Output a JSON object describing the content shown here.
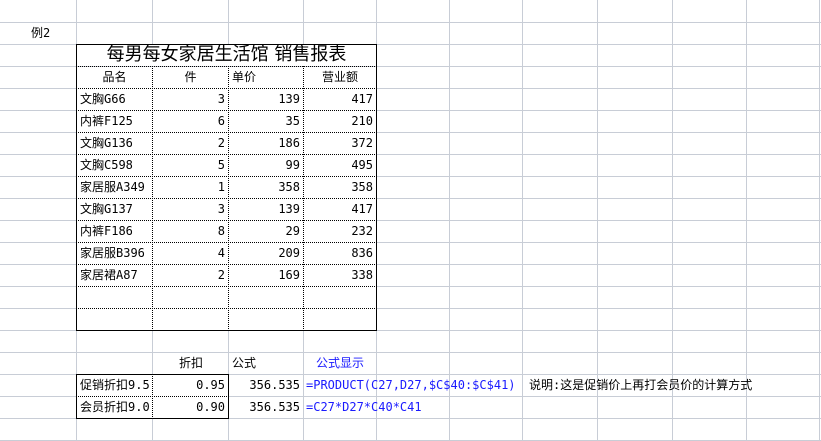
{
  "sheet": {
    "label": "例2",
    "title": "每男每女家居生活馆  销售报表",
    "headers": [
      "品名",
      "件",
      "单价",
      "营业额"
    ],
    "rows": [
      [
        "文胸G66",
        "3",
        "139",
        "417"
      ],
      [
        "内裤F125",
        "6",
        "35",
        "210"
      ],
      [
        "文胸G136",
        "2",
        "186",
        "372"
      ],
      [
        "文胸C598",
        "5",
        "99",
        "495"
      ],
      [
        "家居服A349",
        "1",
        "358",
        "358"
      ],
      [
        "文胸G137",
        "3",
        "139",
        "417"
      ],
      [
        "内裤F186",
        "8",
        "29",
        "232"
      ],
      [
        "家居服B396",
        "4",
        "209",
        "836"
      ],
      [
        "家居裙A87",
        "2",
        "169",
        "338"
      ]
    ],
    "discount_headers": {
      "discount": "折扣",
      "formula": "公式",
      "formula_display": "公式显示"
    },
    "discount_rows": [
      {
        "name": "促销折扣9.5",
        "rate": "0.95",
        "result": "356.535",
        "formula_text": "=PRODUCT(C27,D27,$C$40:$C$41)"
      },
      {
        "name": "会员折扣9.0",
        "rate": "0.90",
        "result": "356.535",
        "formula_text": "=C27*D27*C40*C41"
      }
    ],
    "note": "说明:这是促销价上再打会员价的计算方式",
    "colors": {
      "gridline": "#c8cdd6",
      "formula_text": "#1a1aff",
      "border": "#000000"
    }
  }
}
